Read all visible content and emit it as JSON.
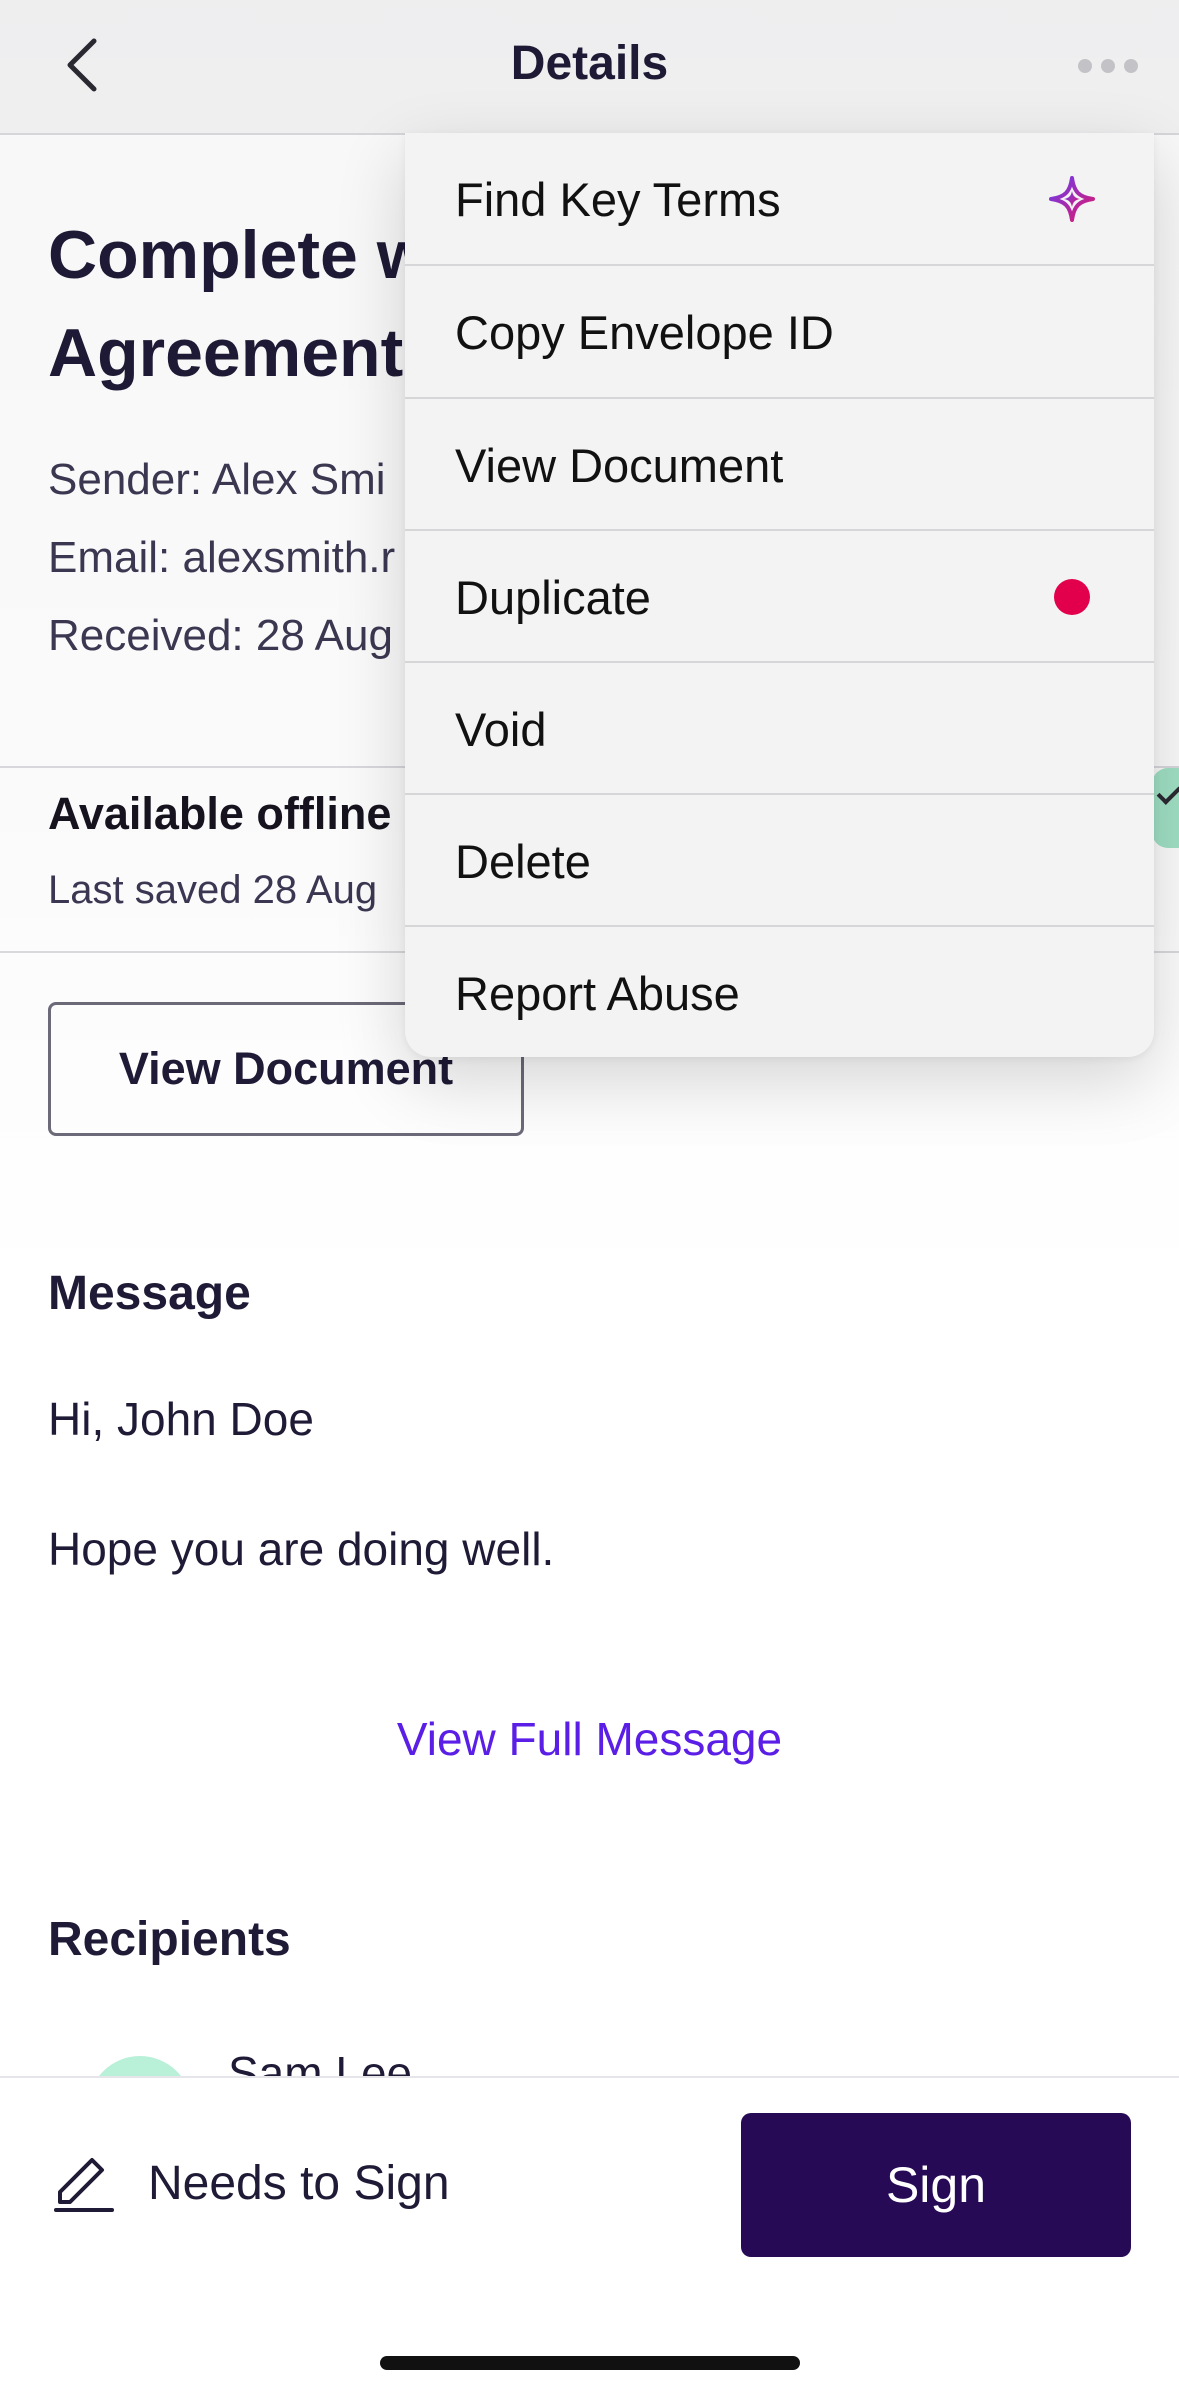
{
  "header": {
    "title": "Details",
    "back_icon": "chevron-left-icon",
    "more_icon": "more-horizontal-icon"
  },
  "envelope": {
    "title_line1": "Complete w",
    "title_line2": "Agreement",
    "sender": "Sender: Alex Smi",
    "email": "Email: alexsmith.r",
    "received": "Received: 28 Aug"
  },
  "offline": {
    "label": "Available offline",
    "last_saved": "Last saved 28 Aug"
  },
  "actions": {
    "view_document": "View Document"
  },
  "message": {
    "heading": "Message",
    "greeting": "Hi, John Doe",
    "body": "Hope you are doing well.",
    "view_full": "View Full Message"
  },
  "recipients": {
    "heading": "Recipients",
    "items": [
      {
        "name": "Sam Lee"
      }
    ]
  },
  "bottom_bar": {
    "status_label": "Needs to Sign",
    "status_icon": "pen-icon",
    "sign_label": "Sign"
  },
  "menu": {
    "items": [
      {
        "label": "Find Key Terms",
        "icon": "sparkle-icon"
      },
      {
        "label": "Copy Envelope ID"
      },
      {
        "label": "View Document"
      },
      {
        "label": "Duplicate",
        "badge": "red-dot"
      },
      {
        "label": "Void"
      },
      {
        "label": "Delete"
      },
      {
        "label": "Report Abuse"
      }
    ]
  },
  "colors": {
    "brand_dark": "#260a56",
    "link": "#5a1ee6",
    "badge_red": "#e2004d",
    "toggle_green": "#a3e4c8"
  }
}
